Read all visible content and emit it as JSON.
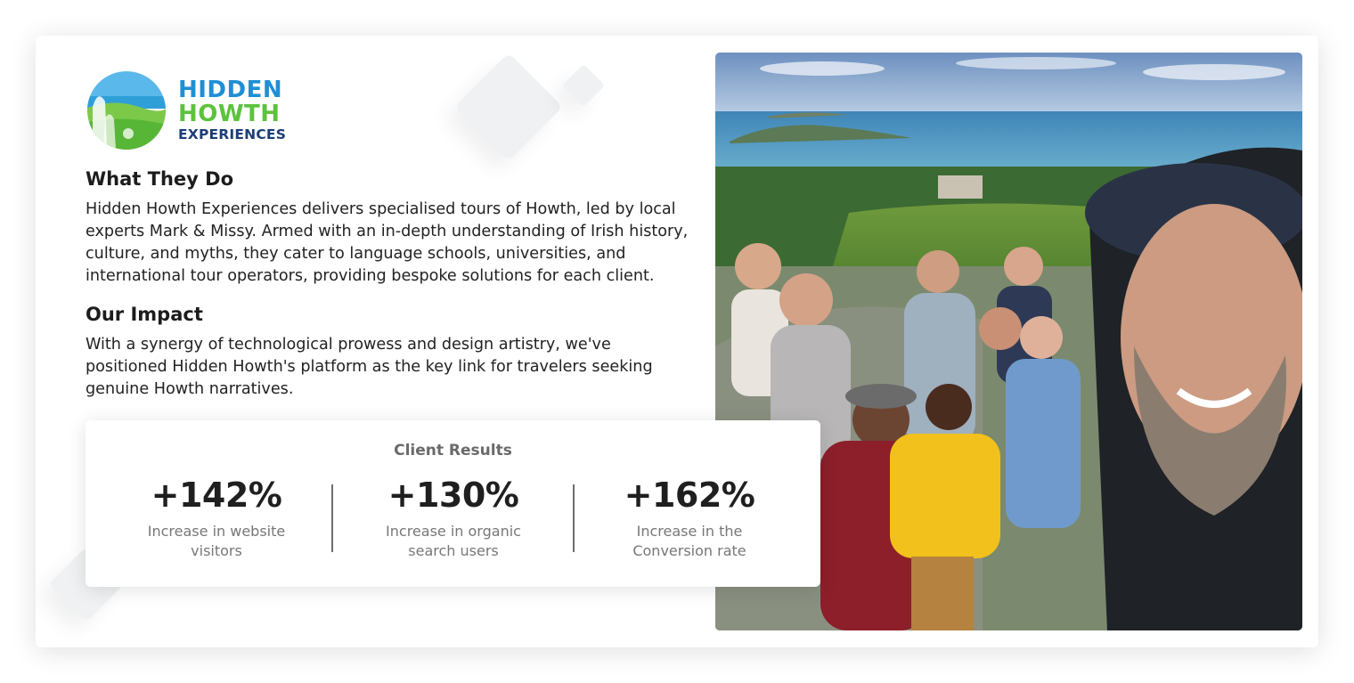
{
  "logo": {
    "line1": "HIDDEN",
    "line2": "HOWTH",
    "line3": "EXPERIENCES"
  },
  "what_they_do": {
    "title": "What They Do",
    "body": "Hidden Howth Experiences delivers specialised tours of Howth, led by local experts Mark & Missy. Armed with an in-depth understanding of Irish history, culture, and myths, they cater to language schools, universities, and international tour operators, providing bespoke solutions for each client."
  },
  "our_impact": {
    "title": "Our Impact",
    "body": "With a synergy of technological prowess and design artistry, we've positioned Hidden Howth's platform as the key link for travelers seeking genuine Howth narratives."
  },
  "results": {
    "title": "Client Results",
    "stats": [
      {
        "value": "+142%",
        "label": "Increase in website visitors"
      },
      {
        "value": "+130%",
        "label": "Increase in organic search users"
      },
      {
        "value": "+162%",
        "label": "Increase in the Conversion rate"
      }
    ]
  },
  "colors": {
    "logo_blue": "#1e8fd6",
    "logo_green": "#5cc33c",
    "logo_navy": "#1c3d78",
    "heading": "#1c1c1c",
    "muted": "#777777"
  }
}
